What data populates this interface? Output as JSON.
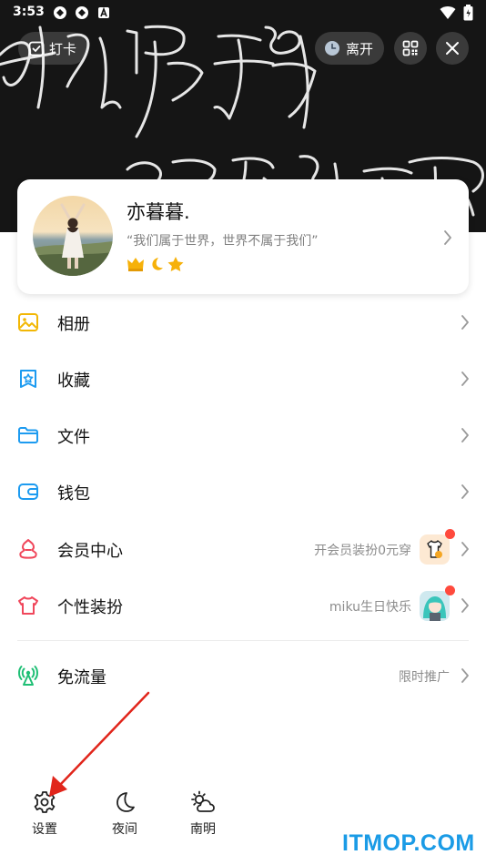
{
  "status_bar": {
    "time": "3:53"
  },
  "header": {
    "checkin_label": "打卡",
    "leave_label": "离开"
  },
  "profile": {
    "nickname": "亦暮暮.",
    "signature": "“我们属于世界，世界不属于我们”",
    "badges": [
      "crown-badge",
      "moon-badge",
      "star-badge"
    ]
  },
  "menu": [
    {
      "label": "相册",
      "icon": "album-icon",
      "color": "#f2b705"
    },
    {
      "label": "收藏",
      "icon": "favorite-icon",
      "color": "#1d9bf0"
    },
    {
      "label": "文件",
      "icon": "folder-icon",
      "color": "#1d9bf0"
    },
    {
      "label": "钱包",
      "icon": "wallet-icon",
      "color": "#1d9bf0"
    },
    {
      "label": "会员中心",
      "icon": "vip-icon",
      "color": "#f0475b",
      "subtitle": "开会员装扮0元穿"
    },
    {
      "label": "个性装扮",
      "icon": "outfit-icon",
      "color": "#f0475b",
      "subtitle": "miku生日快乐"
    },
    {
      "label": "免流量",
      "icon": "free-data-icon",
      "color": "#1fbf75",
      "subtitle": "限时推广"
    }
  ],
  "toolbar": {
    "settings_label": "设置",
    "night_label": "夜间",
    "weather_label": "南明"
  },
  "watermark": "ITMOP.COM"
}
